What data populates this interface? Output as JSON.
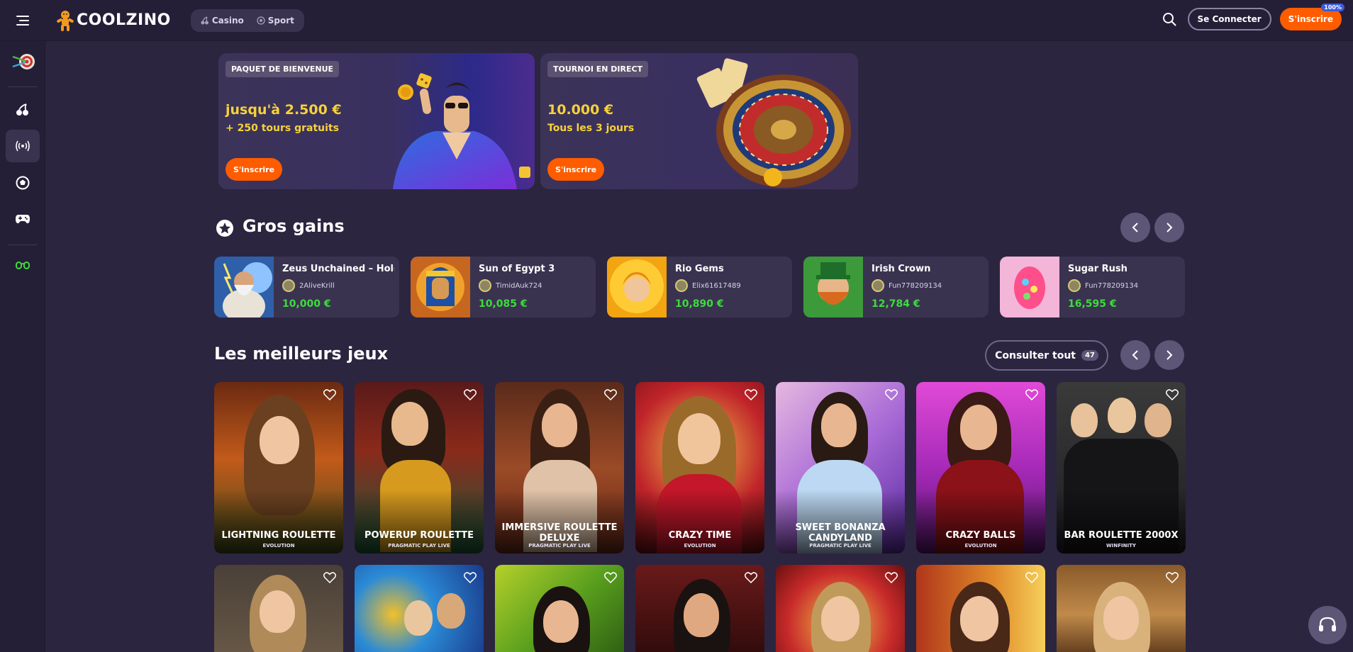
{
  "header": {
    "logo_text": "COOLZINO",
    "nav": [
      {
        "label": "Casino",
        "icon": "cherries-icon"
      },
      {
        "label": "Sport",
        "icon": "soccer-ball-icon"
      }
    ],
    "login_label": "Se Connecter",
    "signup_label": "S'inscrire",
    "signup_badge": "100%"
  },
  "sidebar": {
    "items": [
      {
        "name": "sidebar-item-promotions",
        "icon": "darts-icon"
      },
      {
        "name": "sidebar-item-casino",
        "icon": "cherries-icon"
      },
      {
        "name": "sidebar-item-live",
        "icon": "live-broadcast-icon",
        "active": true
      },
      {
        "name": "sidebar-item-sport",
        "icon": "soccer-ball-icon"
      },
      {
        "name": "sidebar-item-games",
        "icon": "gamepad-icon"
      },
      {
        "name": "sidebar-item-special",
        "icon": "glasses-icon"
      }
    ]
  },
  "promos": [
    {
      "tag": "PAQUET DE BIENVENUE",
      "amount": "jusqu'à 2.500 €",
      "sub": "+ 250 tours gratuits",
      "button": "S'inscrire"
    },
    {
      "tag": "TOURNOI EN DIRECT",
      "amount": "10.000 €",
      "sub": "Tous les 3 jours",
      "button": "S'inscrire"
    }
  ],
  "big_wins": {
    "title": "Gros gains",
    "items": [
      {
        "game": "Zeus Unchained – Hold & Win",
        "user": "2AliveKrill",
        "amount": "10,000 €"
      },
      {
        "game": "Sun of Egypt 3",
        "user": "TimidAuk724",
        "amount": "10,085 €"
      },
      {
        "game": "Rio Gems",
        "user": "Elix61617489",
        "amount": "10,890 €"
      },
      {
        "game": "Irish Crown",
        "user": "Fun778209134",
        "amount": "12,784 €"
      },
      {
        "game": "Sugar Rush",
        "user": "Fun778209134",
        "amount": "16,595 €"
      }
    ]
  },
  "top_games": {
    "title": "Les meilleurs jeux",
    "view_all_label": "Consulter tout",
    "view_all_count": "47",
    "row1": [
      {
        "name": "LIGHTNING ROULETTE",
        "provider": "EVOLUTION"
      },
      {
        "name": "POWERUP ROULETTE",
        "provider": "PRAGMATIC PLAY LIVE"
      },
      {
        "name": "IMMERSIVE ROULETTE DELUXE",
        "provider": "PRAGMATIC PLAY LIVE"
      },
      {
        "name": "CRAZY TIME",
        "provider": "EVOLUTION"
      },
      {
        "name": "SWEET BONANZA CANDYLAND",
        "provider": "PRAGMATIC PLAY LIVE"
      },
      {
        "name": "CRAZY BALLS",
        "provider": "EVOLUTION"
      },
      {
        "name": "BAR ROULETTE 2000X",
        "provider": "WINFINITY"
      }
    ]
  },
  "colors": {
    "background": "#2b2540",
    "panel": "#3a3350",
    "accent": "#ff5c00",
    "win_amount": "#3ddc3c",
    "promo_yellow": "#f6d23a"
  }
}
